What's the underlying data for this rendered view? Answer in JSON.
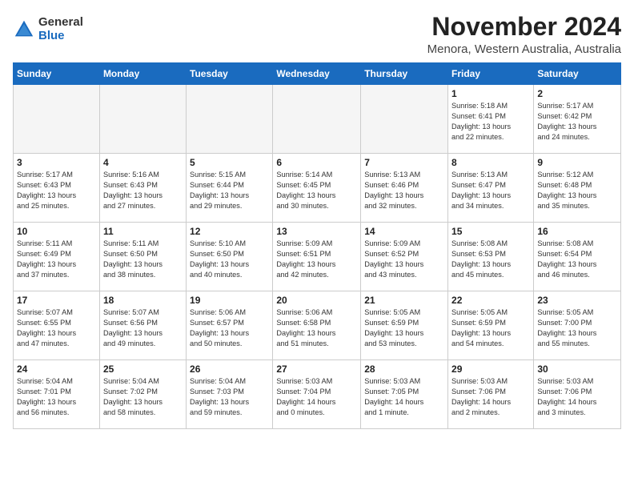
{
  "header": {
    "logo_general": "General",
    "logo_blue": "Blue",
    "month_title": "November 2024",
    "location": "Menora, Western Australia, Australia"
  },
  "columns": [
    "Sunday",
    "Monday",
    "Tuesday",
    "Wednesday",
    "Thursday",
    "Friday",
    "Saturday"
  ],
  "weeks": [
    [
      {
        "day": "",
        "info": ""
      },
      {
        "day": "",
        "info": ""
      },
      {
        "day": "",
        "info": ""
      },
      {
        "day": "",
        "info": ""
      },
      {
        "day": "",
        "info": ""
      },
      {
        "day": "1",
        "info": "Sunrise: 5:18 AM\nSunset: 6:41 PM\nDaylight: 13 hours\nand 22 minutes."
      },
      {
        "day": "2",
        "info": "Sunrise: 5:17 AM\nSunset: 6:42 PM\nDaylight: 13 hours\nand 24 minutes."
      }
    ],
    [
      {
        "day": "3",
        "info": "Sunrise: 5:17 AM\nSunset: 6:43 PM\nDaylight: 13 hours\nand 25 minutes."
      },
      {
        "day": "4",
        "info": "Sunrise: 5:16 AM\nSunset: 6:43 PM\nDaylight: 13 hours\nand 27 minutes."
      },
      {
        "day": "5",
        "info": "Sunrise: 5:15 AM\nSunset: 6:44 PM\nDaylight: 13 hours\nand 29 minutes."
      },
      {
        "day": "6",
        "info": "Sunrise: 5:14 AM\nSunset: 6:45 PM\nDaylight: 13 hours\nand 30 minutes."
      },
      {
        "day": "7",
        "info": "Sunrise: 5:13 AM\nSunset: 6:46 PM\nDaylight: 13 hours\nand 32 minutes."
      },
      {
        "day": "8",
        "info": "Sunrise: 5:13 AM\nSunset: 6:47 PM\nDaylight: 13 hours\nand 34 minutes."
      },
      {
        "day": "9",
        "info": "Sunrise: 5:12 AM\nSunset: 6:48 PM\nDaylight: 13 hours\nand 35 minutes."
      }
    ],
    [
      {
        "day": "10",
        "info": "Sunrise: 5:11 AM\nSunset: 6:49 PM\nDaylight: 13 hours\nand 37 minutes."
      },
      {
        "day": "11",
        "info": "Sunrise: 5:11 AM\nSunset: 6:50 PM\nDaylight: 13 hours\nand 38 minutes."
      },
      {
        "day": "12",
        "info": "Sunrise: 5:10 AM\nSunset: 6:50 PM\nDaylight: 13 hours\nand 40 minutes."
      },
      {
        "day": "13",
        "info": "Sunrise: 5:09 AM\nSunset: 6:51 PM\nDaylight: 13 hours\nand 42 minutes."
      },
      {
        "day": "14",
        "info": "Sunrise: 5:09 AM\nSunset: 6:52 PM\nDaylight: 13 hours\nand 43 minutes."
      },
      {
        "day": "15",
        "info": "Sunrise: 5:08 AM\nSunset: 6:53 PM\nDaylight: 13 hours\nand 45 minutes."
      },
      {
        "day": "16",
        "info": "Sunrise: 5:08 AM\nSunset: 6:54 PM\nDaylight: 13 hours\nand 46 minutes."
      }
    ],
    [
      {
        "day": "17",
        "info": "Sunrise: 5:07 AM\nSunset: 6:55 PM\nDaylight: 13 hours\nand 47 minutes."
      },
      {
        "day": "18",
        "info": "Sunrise: 5:07 AM\nSunset: 6:56 PM\nDaylight: 13 hours\nand 49 minutes."
      },
      {
        "day": "19",
        "info": "Sunrise: 5:06 AM\nSunset: 6:57 PM\nDaylight: 13 hours\nand 50 minutes."
      },
      {
        "day": "20",
        "info": "Sunrise: 5:06 AM\nSunset: 6:58 PM\nDaylight: 13 hours\nand 51 minutes."
      },
      {
        "day": "21",
        "info": "Sunrise: 5:05 AM\nSunset: 6:59 PM\nDaylight: 13 hours\nand 53 minutes."
      },
      {
        "day": "22",
        "info": "Sunrise: 5:05 AM\nSunset: 6:59 PM\nDaylight: 13 hours\nand 54 minutes."
      },
      {
        "day": "23",
        "info": "Sunrise: 5:05 AM\nSunset: 7:00 PM\nDaylight: 13 hours\nand 55 minutes."
      }
    ],
    [
      {
        "day": "24",
        "info": "Sunrise: 5:04 AM\nSunset: 7:01 PM\nDaylight: 13 hours\nand 56 minutes."
      },
      {
        "day": "25",
        "info": "Sunrise: 5:04 AM\nSunset: 7:02 PM\nDaylight: 13 hours\nand 58 minutes."
      },
      {
        "day": "26",
        "info": "Sunrise: 5:04 AM\nSunset: 7:03 PM\nDaylight: 13 hours\nand 59 minutes."
      },
      {
        "day": "27",
        "info": "Sunrise: 5:03 AM\nSunset: 7:04 PM\nDaylight: 14 hours\nand 0 minutes."
      },
      {
        "day": "28",
        "info": "Sunrise: 5:03 AM\nSunset: 7:05 PM\nDaylight: 14 hours\nand 1 minute."
      },
      {
        "day": "29",
        "info": "Sunrise: 5:03 AM\nSunset: 7:06 PM\nDaylight: 14 hours\nand 2 minutes."
      },
      {
        "day": "30",
        "info": "Sunrise: 5:03 AM\nSunset: 7:06 PM\nDaylight: 14 hours\nand 3 minutes."
      }
    ]
  ]
}
